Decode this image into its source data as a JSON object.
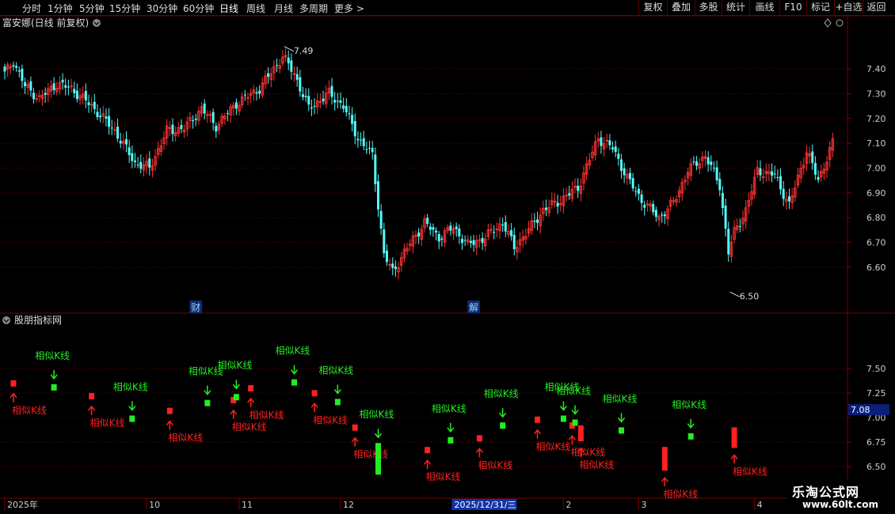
{
  "toolbar": {
    "periods": [
      "分时",
      "1分钟",
      "5分钟",
      "15分钟",
      "30分钟",
      "60分钟",
      "日线",
      "周线",
      "月线",
      "多周期",
      "更多 >"
    ],
    "active_period": "日线",
    "right_buttons": [
      "复权",
      "叠加",
      "多股",
      "统计",
      "画线",
      "F10",
      "标记",
      "+自选",
      "返回"
    ]
  },
  "main_panel": {
    "title": "富安娜(日线 前复权)",
    "high_marker": "7.49",
    "low_marker": "6.50",
    "events": [
      {
        "label": "财",
        "index": 66
      },
      {
        "label": "解",
        "index": 162
      }
    ]
  },
  "indicator_panel": {
    "title": "股朋指标网",
    "value_badge": "7.08",
    "signal_label": "相似K线"
  },
  "time_axis": {
    "labels": [
      {
        "label": "2025年",
        "index": 0
      },
      {
        "label": "10",
        "index": 49
      },
      {
        "label": "11",
        "index": 81
      },
      {
        "label": "12",
        "index": 116
      },
      {
        "label": "2",
        "index": 193
      },
      {
        "label": "3",
        "index": 219
      },
      {
        "label": "4",
        "index": 259
      }
    ],
    "cursor_label": {
      "label": "2025/12/31/三",
      "index": 155
    }
  },
  "watermark": {
    "line1": "乐淘公式网",
    "line2": "www.60lt.com"
  },
  "colors": {
    "up": "#ff3333",
    "down": "#54fcfc",
    "grid": "#7a0000",
    "axis_text": "#cccccc",
    "sig_up": "#ff2020",
    "sig_down": "#22ee22"
  },
  "chart_data": {
    "type": "candlestick",
    "y_axis_main": {
      "ticks": [
        6.6,
        6.7,
        6.8,
        6.9,
        7.0,
        7.1,
        7.2,
        7.3,
        7.4
      ],
      "range": [
        6.45,
        7.55
      ]
    },
    "y_axis_indicator": {
      "ticks": [
        6.5,
        6.75,
        7.0,
        7.25,
        7.5
      ],
      "range": [
        6.3,
        7.8
      ]
    },
    "close_waypoints": [
      [
        0,
        7.38
      ],
      [
        3,
        7.43
      ],
      [
        7,
        7.33
      ],
      [
        12,
        7.28
      ],
      [
        18,
        7.34
      ],
      [
        23,
        7.32
      ],
      [
        30,
        7.25
      ],
      [
        38,
        7.15
      ],
      [
        45,
        7.02
      ],
      [
        50,
        7.0
      ],
      [
        56,
        7.15
      ],
      [
        62,
        7.16
      ],
      [
        68,
        7.24
      ],
      [
        73,
        7.17
      ],
      [
        80,
        7.26
      ],
      [
        88,
        7.32
      ],
      [
        96,
        7.45
      ],
      [
        100,
        7.38
      ],
      [
        105,
        7.24
      ],
      [
        112,
        7.3
      ],
      [
        117,
        7.25
      ],
      [
        122,
        7.12
      ],
      [
        127,
        7.05
      ],
      [
        131,
        6.65
      ],
      [
        134,
        6.58
      ],
      [
        138,
        6.66
      ],
      [
        145,
        6.78
      ],
      [
        150,
        6.72
      ],
      [
        155,
        6.76
      ],
      [
        160,
        6.69
      ],
      [
        166,
        6.72
      ],
      [
        172,
        6.78
      ],
      [
        176,
        6.68
      ],
      [
        181,
        6.75
      ],
      [
        186,
        6.83
      ],
      [
        192,
        6.87
      ],
      [
        198,
        6.92
      ],
      [
        205,
        7.12
      ],
      [
        210,
        7.08
      ],
      [
        215,
        6.96
      ],
      [
        220,
        6.87
      ],
      [
        226,
        6.8
      ],
      [
        231,
        6.86
      ],
      [
        236,
        6.99
      ],
      [
        242,
        7.05
      ],
      [
        247,
        6.93
      ],
      [
        250,
        6.66
      ],
      [
        252,
        6.74
      ],
      [
        256,
        6.83
      ],
      [
        260,
        6.99
      ],
      [
        266,
        6.97
      ],
      [
        271,
        6.85
      ],
      [
        277,
        7.07
      ],
      [
        281,
        6.95
      ],
      [
        286,
        7.1
      ]
    ],
    "signals": [
      {
        "index": 3,
        "dir": "up",
        "value": 7.38
      },
      {
        "index": 17,
        "dir": "down",
        "value": 7.34
      },
      {
        "index": 30,
        "dir": "up",
        "value": 7.25
      },
      {
        "index": 44,
        "dir": "down",
        "value": 7.02
      },
      {
        "index": 57,
        "dir": "up",
        "value": 7.1
      },
      {
        "index": 70,
        "dir": "down",
        "value": 7.18
      },
      {
        "index": 79,
        "dir": "up",
        "value": 7.21
      },
      {
        "index": 80,
        "dir": "down",
        "value": 7.24
      },
      {
        "index": 85,
        "dir": "up",
        "value": 7.33
      },
      {
        "index": 100,
        "dir": "down",
        "value": 7.39
      },
      {
        "index": 107,
        "dir": "up",
        "value": 7.28
      },
      {
        "index": 115,
        "dir": "down",
        "value": 7.19
      },
      {
        "index": 121,
        "dir": "up",
        "value": 6.93
      },
      {
        "index": 129,
        "dir": "down",
        "value": 6.74
      },
      {
        "index": 146,
        "dir": "up",
        "value": 6.7
      },
      {
        "index": 154,
        "dir": "down",
        "value": 6.8
      },
      {
        "index": 164,
        "dir": "up",
        "value": 6.82
      },
      {
        "index": 172,
        "dir": "down",
        "value": 6.95
      },
      {
        "index": 184,
        "dir": "up",
        "value": 7.01
      },
      {
        "index": 193,
        "dir": "down",
        "value": 7.02
      },
      {
        "index": 196,
        "dir": "up",
        "value": 6.95
      },
      {
        "index": 197,
        "dir": "down",
        "value": 6.98
      },
      {
        "index": 199,
        "dir": "up",
        "value": 6.92
      },
      {
        "index": 213,
        "dir": "down",
        "value": 6.9
      },
      {
        "index": 228,
        "dir": "up",
        "value": 6.7
      },
      {
        "index": 237,
        "dir": "down",
        "value": 6.84
      },
      {
        "index": 252,
        "dir": "up",
        "value": 6.9
      }
    ]
  }
}
